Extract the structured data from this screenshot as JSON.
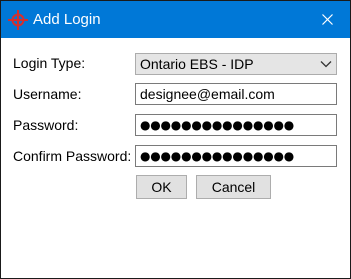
{
  "window": {
    "title": "Add Login",
    "title_bar_color": "#0078d7",
    "app_icon": "red-crosshair-icon",
    "close_icon": "close-icon"
  },
  "form": {
    "login_type": {
      "label": "Login Type:",
      "value": "Ontario EBS - IDP"
    },
    "username": {
      "label": "Username:",
      "value": "designee@email.com"
    },
    "password": {
      "label": "Password:",
      "value": "●●●●●●●●●●●●●●●"
    },
    "confirm_password": {
      "label": "Confirm Password:",
      "value": "●●●●●●●●●●●●●●●"
    }
  },
  "buttons": {
    "ok": "OK",
    "cancel": "Cancel"
  }
}
